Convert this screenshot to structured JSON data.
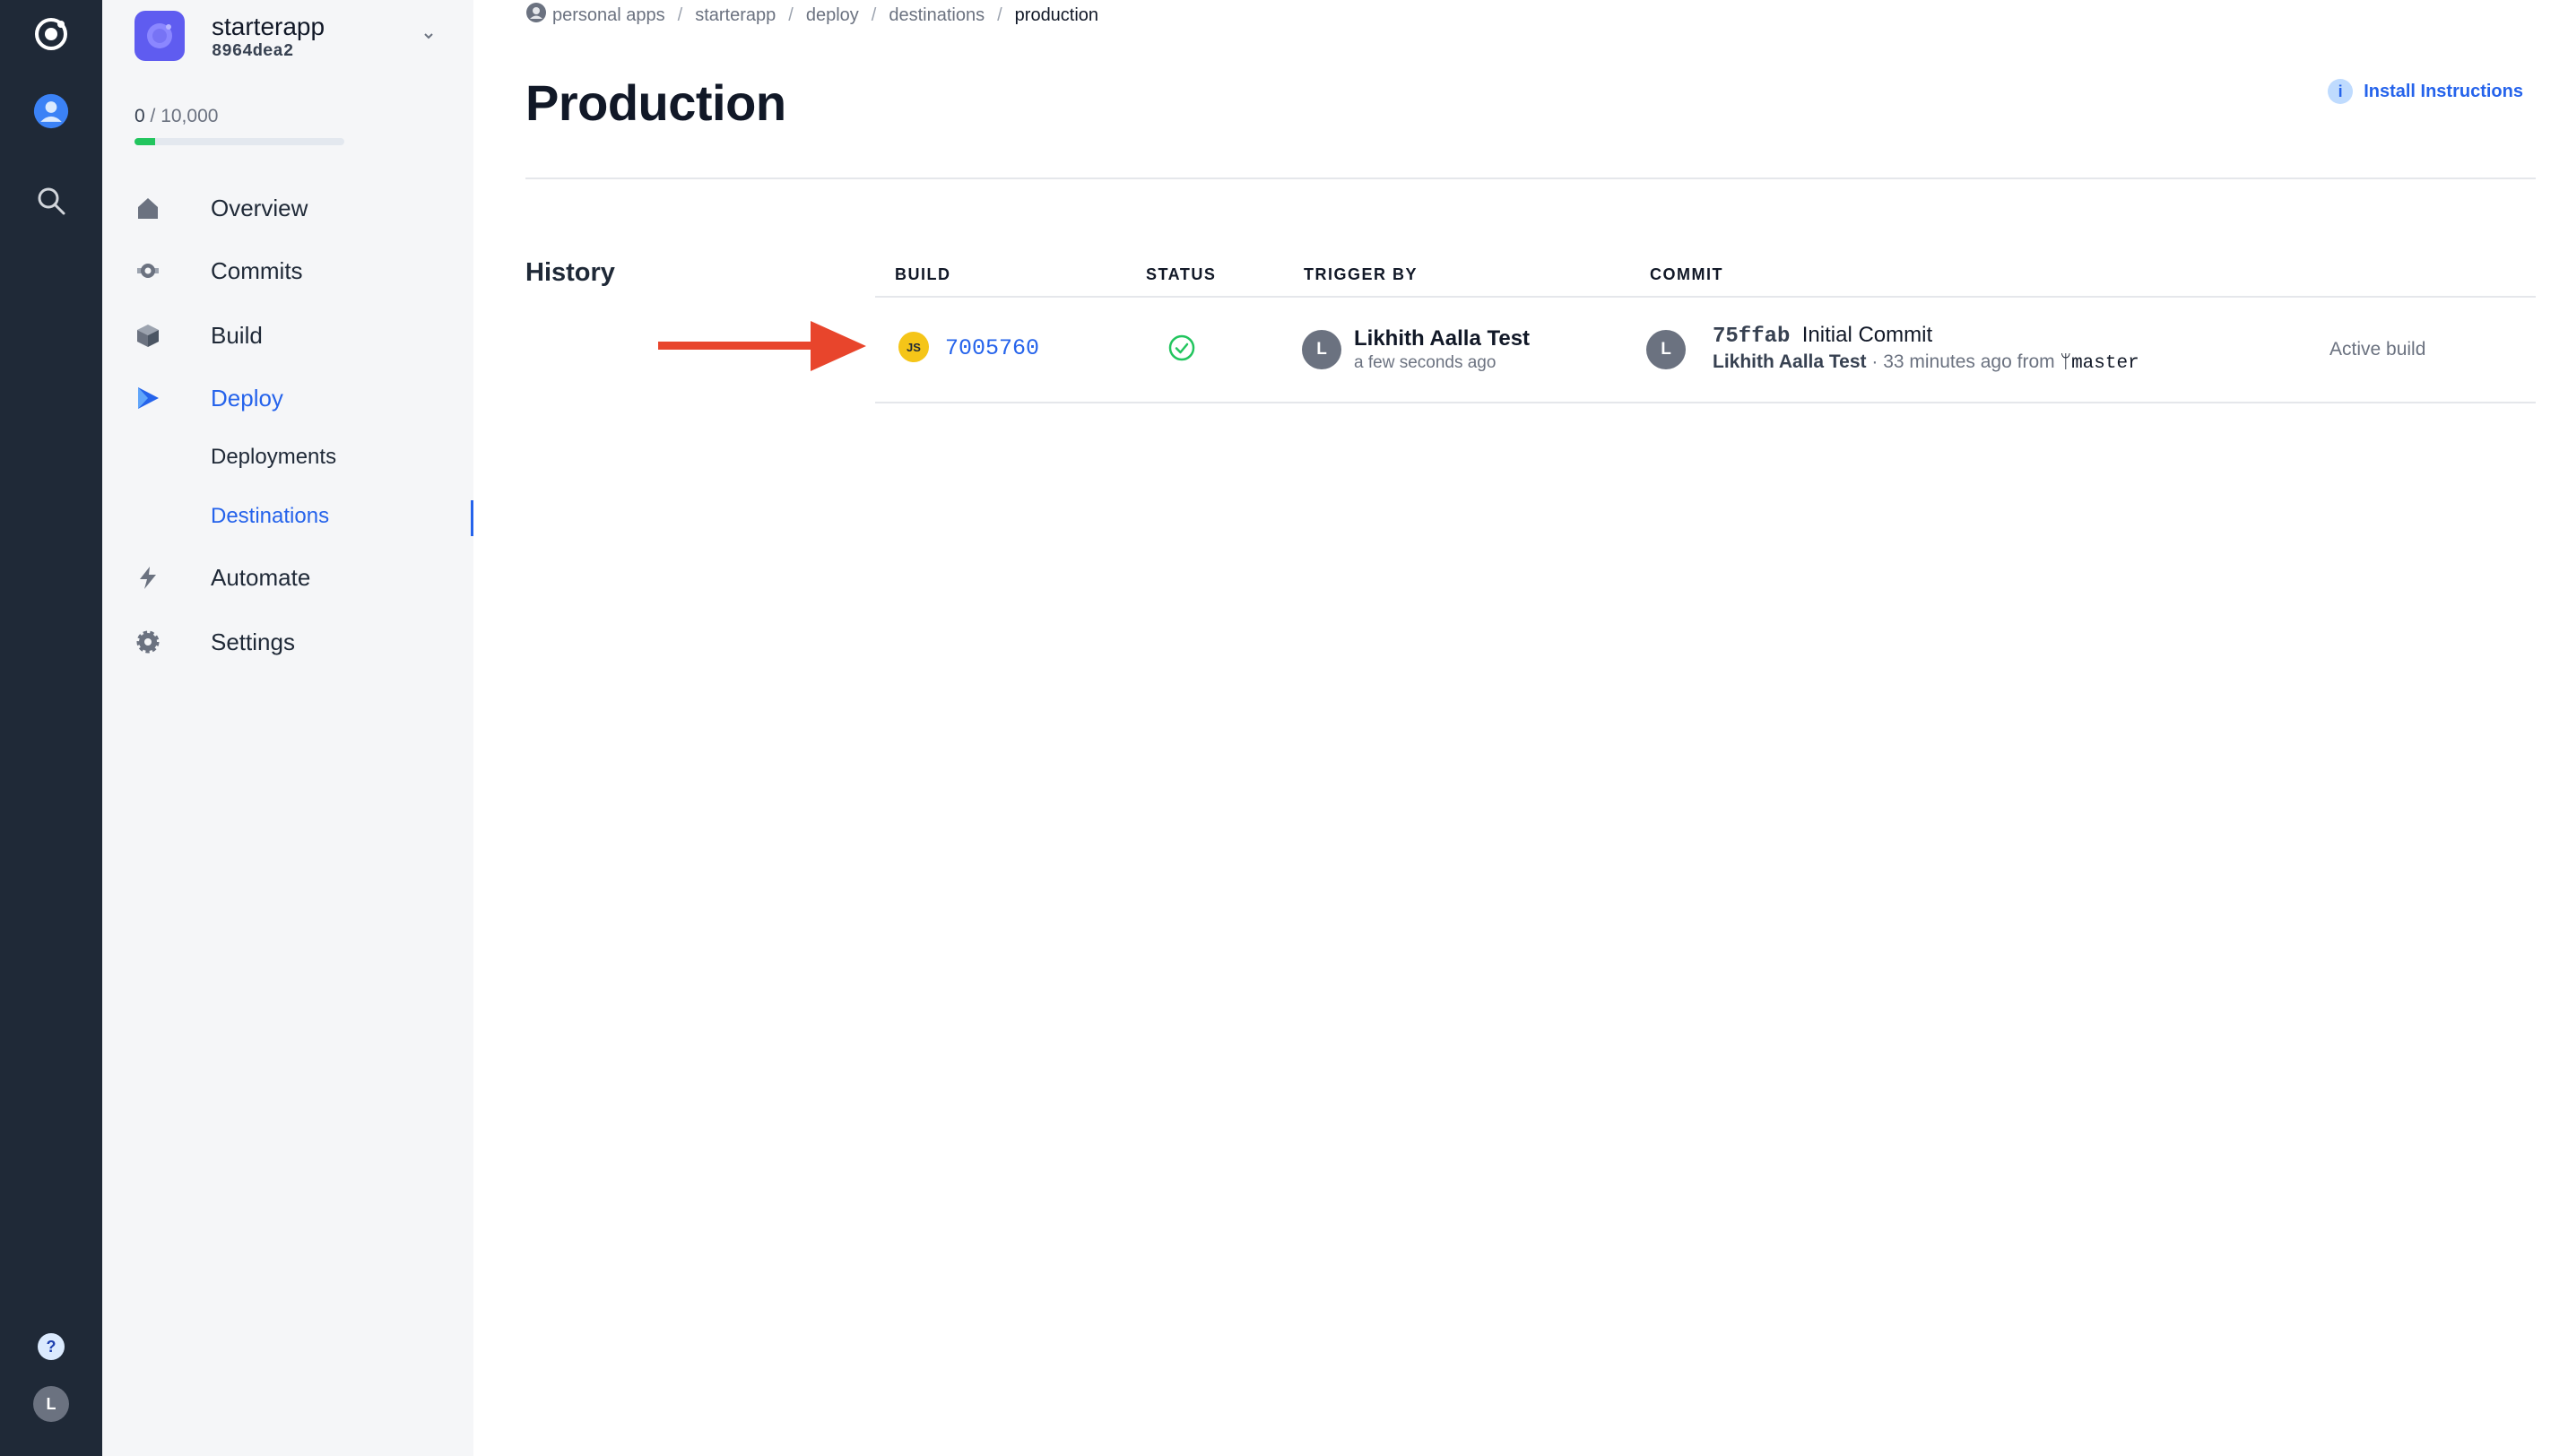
{
  "app": {
    "name": "starterapp",
    "id": "8964dea2",
    "usage_used": "0",
    "usage_total": "/ 10,000",
    "usage_fraction": 0.1
  },
  "rail": {
    "bottom_avatar_letter": "L",
    "help_glyph": "?"
  },
  "nav": {
    "overview": "Overview",
    "commits": "Commits",
    "build": "Build",
    "deploy": "Deploy",
    "deployments": "Deployments",
    "destinations": "Destinations",
    "automate": "Automate",
    "settings": "Settings"
  },
  "breadcrumb": {
    "items": [
      "personal apps",
      "starterapp",
      "deploy",
      "destinations"
    ],
    "current": "production",
    "separator": "/"
  },
  "page": {
    "title": "Production",
    "install_label": "Install Instructions",
    "install_icon_glyph": "i"
  },
  "history": {
    "label": "History",
    "columns": {
      "build": "BUILD",
      "status": "STATUS",
      "trigger": "TRIGGER BY",
      "commit": "COMMIT"
    },
    "rows": [
      {
        "build_badge": "JS",
        "build_id": "7005760",
        "status": "success",
        "trigger_avatar": "L",
        "trigger_name": "Likhith Aalla Test",
        "trigger_time": "a few seconds ago",
        "commit_avatar": "L",
        "commit_sha": "75ffab",
        "commit_message": "Initial Commit",
        "commit_author": "Likhith Aalla Test",
        "commit_meta": " · 33 minutes ago from ",
        "branch_glyph": "ᛘ",
        "branch": "master",
        "active_label": "Active build"
      }
    ]
  },
  "colors": {
    "rail": "#1f2937",
    "sidebar": "#f5f6f8",
    "accent": "#2563eb",
    "app_icon": "#5f5cf0",
    "success": "#22c55e",
    "arrow": "#e8452c",
    "js_badge": "#f5c518"
  }
}
